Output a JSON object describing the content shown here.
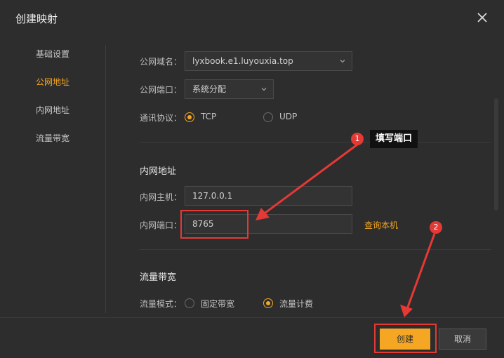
{
  "dialog": {
    "title": "创建映射"
  },
  "sidebar": {
    "items": [
      {
        "label": "基础设置"
      },
      {
        "label": "公网地址"
      },
      {
        "label": "内网地址"
      },
      {
        "label": "流量带宽"
      }
    ]
  },
  "public": {
    "domain_label": "公网域名：",
    "domain_value": "lyxbook.e1.luyouxia.top",
    "port_label": "公网端口：",
    "port_value": "系统分配",
    "protocol_label": "通讯协议：",
    "protocol_options": [
      "TCP",
      "UDP"
    ],
    "protocol_selected": "TCP"
  },
  "internal": {
    "section_title": "内网地址",
    "host_label": "内网主机：",
    "host_value": "127.0.0.1",
    "port_label": "内网端口：",
    "port_value": "8765",
    "lookup_link": "查询本机"
  },
  "bandwidth": {
    "section_title": "流量带宽",
    "mode_label": "流量模式：",
    "options": [
      "固定带宽",
      "流量计费"
    ],
    "selected": "流量计费"
  },
  "annotations": {
    "step1_number": "1",
    "step1_text": "填写端口",
    "step2_number": "2"
  },
  "footer": {
    "create_label": "创建",
    "cancel_label": "取消"
  },
  "colors": {
    "accent": "#f5a623",
    "annotation": "#e53935",
    "background": "#2d2d2d"
  }
}
